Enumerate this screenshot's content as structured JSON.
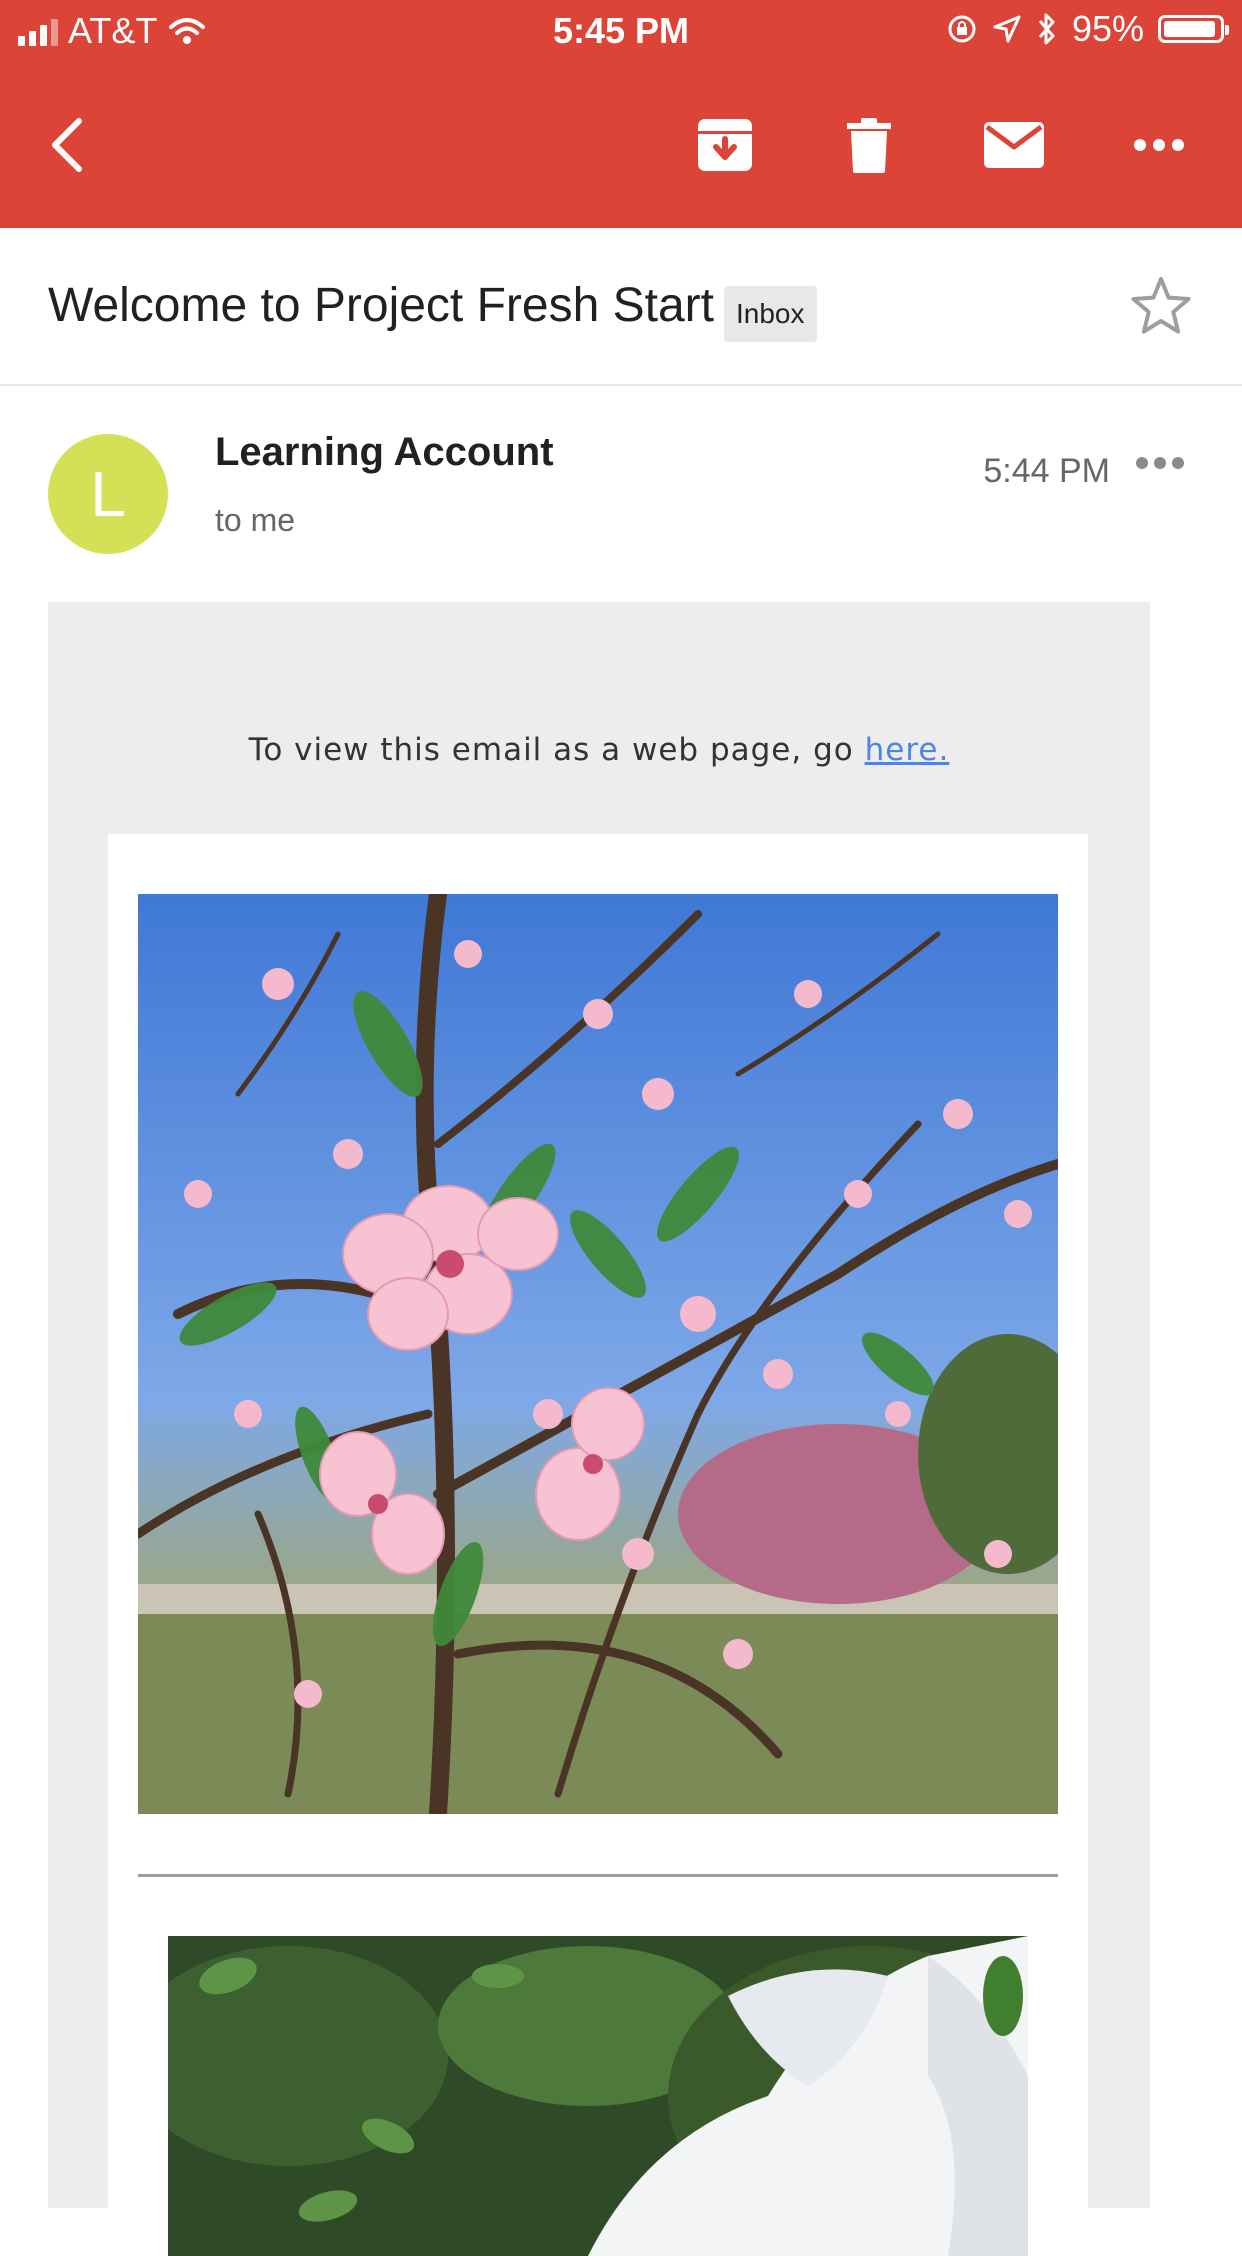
{
  "status_bar": {
    "carrier": "AT&T",
    "time": "5:45 PM",
    "battery": "95%"
  },
  "toolbar": {
    "back": "back-arrow-icon",
    "archive": "archive-icon",
    "delete": "trash-icon",
    "mark_unread": "mail-icon",
    "more": "more-horizontal-icon"
  },
  "subject": {
    "title": "Welcome to Project Fresh Start",
    "label": "Inbox"
  },
  "message": {
    "avatar_letter": "L",
    "sender": "Learning Account",
    "recipients": "to me",
    "time": "5:44 PM"
  },
  "body": {
    "webpage_prefix": "To view this email as a web page, go",
    "webpage_link": "here."
  },
  "colors": {
    "app_bar": "#db4437",
    "avatar": "#d4e157",
    "link": "#4a86e8"
  }
}
